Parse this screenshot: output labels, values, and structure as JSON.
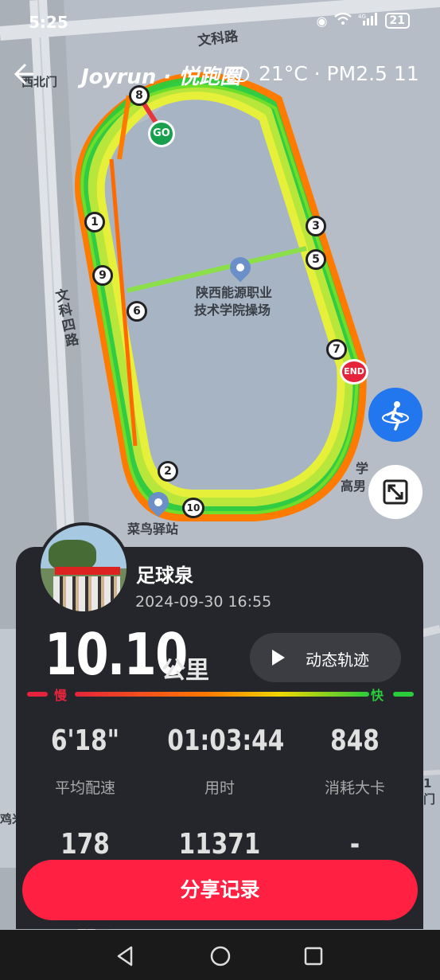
{
  "status_bar": {
    "time": "5:25",
    "icons": [
      "eye-icon",
      "wifi-icon",
      "signal-4g-icon"
    ],
    "battery": "21"
  },
  "header": {
    "brand": "Joyrun · 悦跑圈",
    "weather": "21°C · PM2.5 11"
  },
  "map": {
    "labels": {
      "road_top": "文科路",
      "gate": "西北门",
      "road_left": "文科四路",
      "venue_line1": "陕西能源职业",
      "venue_line2": "技术学院操场",
      "station": "菜鸟驿站",
      "school_line1": "学",
      "school_line2": "高男",
      "left_bottom": "鸡米",
      "right_bottom": "1门"
    },
    "start_label": "GO",
    "end_label": "END",
    "km_markers": [
      "1",
      "2",
      "3",
      "5",
      "6",
      "7",
      "8",
      "9",
      "10"
    ]
  },
  "record": {
    "user_name": "足球泉",
    "date": "2024-09-30 16:55",
    "distance": "10.10",
    "distance_unit": "公里",
    "replay_label": "动态轨迹",
    "slow_label": "慢",
    "fast_label": "快",
    "stats_row1": [
      {
        "value": "6'18\"",
        "label": "平均配速"
      },
      {
        "value": "01:03:44",
        "label": "用时"
      },
      {
        "value": "848",
        "label": "消耗大卡"
      }
    ],
    "stats_row2": [
      {
        "value": "178"
      },
      {
        "value": "11371"
      },
      {
        "value": "-"
      }
    ],
    "share_label": "分享记录"
  },
  "colors": {
    "accent": "#ff2042",
    "panel": "#25262b",
    "route_fast": "#2acc3c",
    "route_slow": "#ff7a00",
    "action_blue": "#2277ee"
  }
}
